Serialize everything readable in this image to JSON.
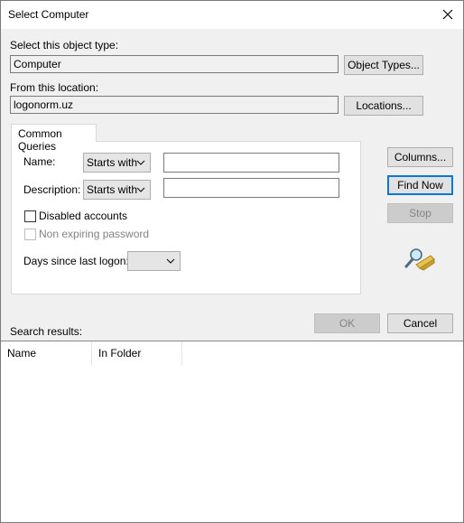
{
  "window": {
    "title": "Select Computer"
  },
  "object_type": {
    "label": "Select this object type:",
    "value": "Computer",
    "button": "Object Types..."
  },
  "location": {
    "label": "From this location:",
    "value": "logonorm.uz",
    "button": "Locations..."
  },
  "tab": {
    "label": "Common Queries"
  },
  "query": {
    "name_label": "Name:",
    "name_mode": "Starts with",
    "name_value": "",
    "description_label": "Description:",
    "description_mode": "Starts with",
    "description_value": "",
    "disabled_accounts": "Disabled accounts",
    "non_expiring_password": "Non expiring password",
    "days_label": "Days since last logon:",
    "days_value": ""
  },
  "side_buttons": {
    "columns": "Columns...",
    "find_now": "Find Now",
    "stop": "Stop"
  },
  "footer": {
    "ok": "OK",
    "cancel": "Cancel"
  },
  "results": {
    "label": "Search results:",
    "columns": [
      "Name",
      "In Folder"
    ]
  },
  "icons": {
    "close": "close-icon",
    "search": "magnifier-search-icon"
  },
  "colors": {
    "accent": "#0078d7",
    "face": "#f0f0f0",
    "disabled_text": "#838383"
  }
}
